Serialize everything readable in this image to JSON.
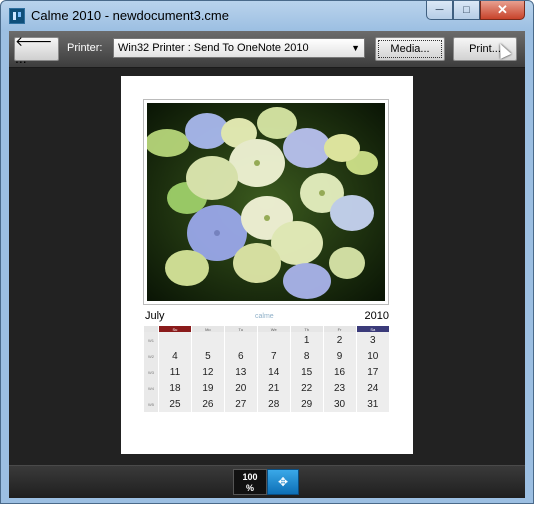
{
  "window": {
    "title": "Calme 2010 - newdocument3.cme",
    "minimize": "─",
    "maximize": "□",
    "close": "✕"
  },
  "toolbar": {
    "back_label": "🡐 ...",
    "printer_label": "Printer:",
    "printer_value": "Win32 Printer : Send To OneNote 2010",
    "media_label": "Media...",
    "print_label": "Print..."
  },
  "calendar": {
    "month": "July",
    "year": "2010",
    "logo": "calme",
    "weekday_headers": [
      "Su",
      "Mo",
      "Tu",
      "We",
      "Th",
      "Fr",
      "Sa"
    ],
    "week_numbers": [
      "W1",
      "W2",
      "W3",
      "W4",
      "W5"
    ],
    "weeks": [
      [
        "",
        "",
        "",
        "",
        "1",
        "2",
        "3"
      ],
      [
        "4",
        "5",
        "6",
        "7",
        "8",
        "9",
        "10"
      ],
      [
        "11",
        "12",
        "13",
        "14",
        "15",
        "16",
        "17"
      ],
      [
        "18",
        "19",
        "20",
        "21",
        "22",
        "23",
        "24"
      ],
      [
        "25",
        "26",
        "27",
        "28",
        "29",
        "30",
        "31"
      ]
    ]
  },
  "zoom": {
    "value": "100",
    "unit": "%",
    "fit_icon": "move-arrows-icon"
  },
  "colors": {
    "sunday": "#8a1b1b",
    "saturday": "#34347a",
    "accent": "#0d6fb6"
  }
}
